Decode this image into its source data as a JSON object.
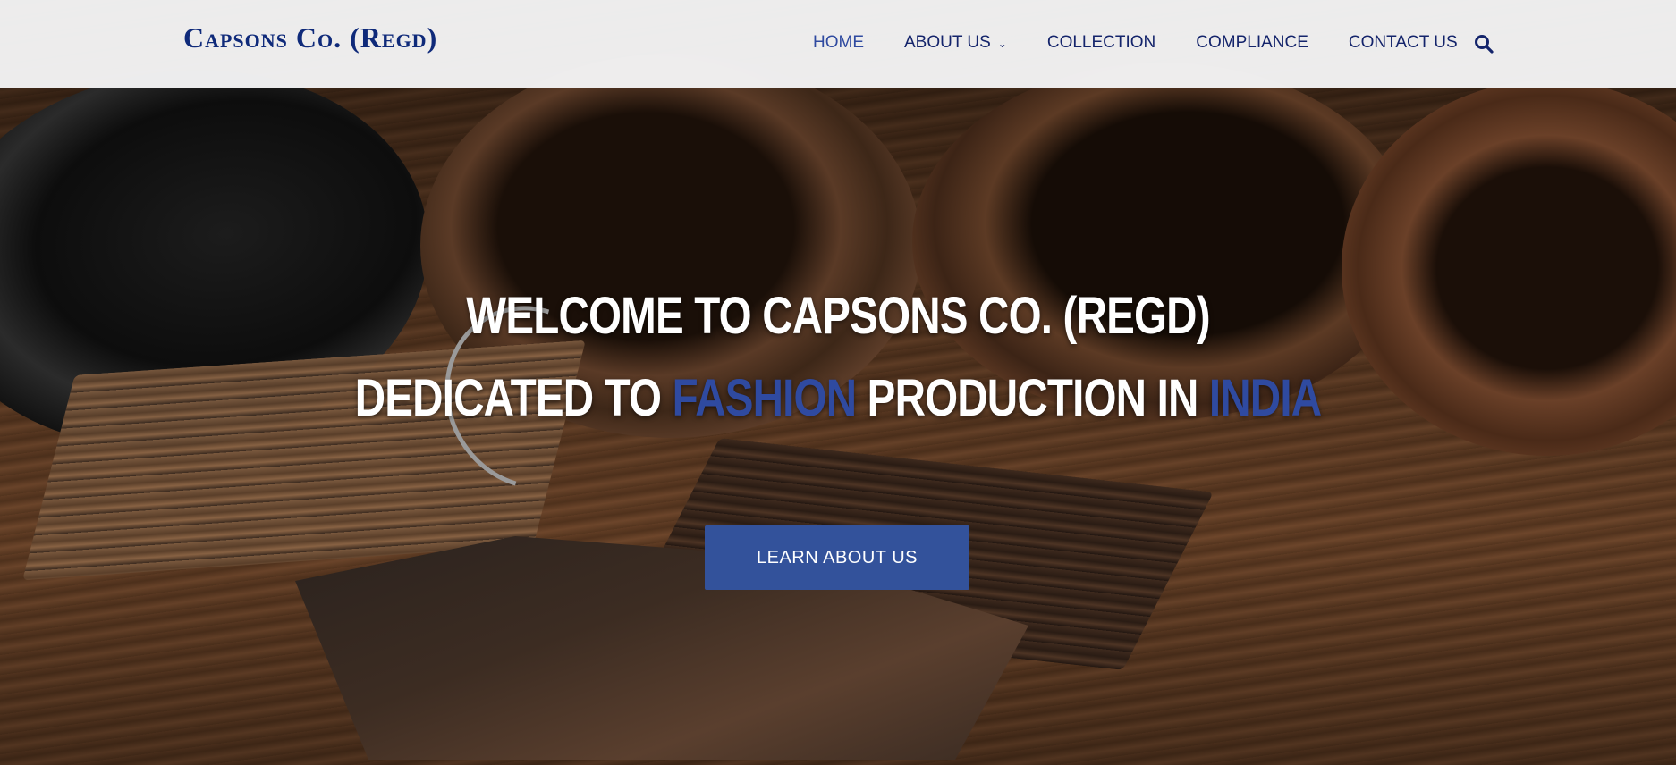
{
  "header": {
    "logo": "Capsons Co. (Regd)",
    "nav": [
      {
        "label": "HOME",
        "active": true
      },
      {
        "label": "ABOUT US",
        "has_dropdown": true
      },
      {
        "label": "COLLECTION"
      },
      {
        "label": "COMPLIANCE"
      },
      {
        "label": "CONTACT US"
      }
    ],
    "search_icon": "search-icon"
  },
  "hero": {
    "line1": "WELCOME TO CAPSONS CO. (REGD)",
    "line2_parts": [
      "DEDICATED TO ",
      "FASHION",
      " PRODUCTION IN ",
      "INDIA"
    ],
    "cta_label": "LEARN ABOUT US",
    "background": "leather rolls and swatches on wooden table"
  },
  "colors": {
    "brand_navy": "#14246b",
    "accent_blue": "#2f4aa0",
    "button_blue": "#33529b",
    "header_bg": "#f5f5f6"
  }
}
